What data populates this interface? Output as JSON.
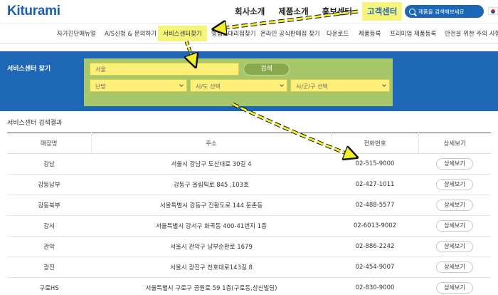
{
  "header": {
    "logo_text": "Kiturami",
    "nav": [
      "회사소개",
      "제품소개",
      "홍보센터",
      "고객센터"
    ],
    "search_placeholder": "제품을 검색해보세요"
  },
  "subnav": [
    "자가진단매뉴얼",
    "A/S신청 & 문의하기",
    "서비스센터찾기",
    "영업소대리점찾기",
    "온라인 공식판매점 찾기",
    "다운로드",
    "제품등록",
    "프리미엄 제품등록",
    "안전을 위한 주의 사항"
  ],
  "search_panel": {
    "title": "서비스센터 찾기",
    "keyword_value": "서울",
    "search_button": "검색",
    "select_product": "난방",
    "select_city": "시/도 선택",
    "select_district": "시/군/구 선택"
  },
  "results": {
    "title": "서비스센터 검색결과",
    "columns": [
      "매장명",
      "주소",
      "전화번호",
      "상세보기"
    ],
    "detail_label": "상세보기",
    "rows": [
      {
        "name": "강남",
        "address": "서울시 강남구 도산대로 30길 4",
        "phone": "02-515-9000"
      },
      {
        "name": "강동남부",
        "address": "강동구 올림픽로 845 ,103호",
        "phone": "02-427-1011"
      },
      {
        "name": "강동북부",
        "address": "서울특별시 강동구 진황도로 144 둔촌동",
        "phone": "02-488-5577"
      },
      {
        "name": "강서",
        "address": "서울특별시 강서구 화곡동 400-41번지 1층",
        "phone": "02-6013-9002"
      },
      {
        "name": "관악",
        "address": "서울시 관악구 남부순환로 1679",
        "phone": "02-886-2242"
      },
      {
        "name": "광진",
        "address": "서울시 광진구 천호대로143길 8",
        "phone": "02-454-9007"
      },
      {
        "name": "구로HS",
        "address": "서울특별시 구로구 공원로 59 1층(구로동,상신빌딩)",
        "phone": "02-830-9000"
      }
    ]
  },
  "colors": {
    "brand_blue": "#1e67b5",
    "highlight_yellow": "#f6f57a",
    "search_box_green": "#a6c86a"
  }
}
